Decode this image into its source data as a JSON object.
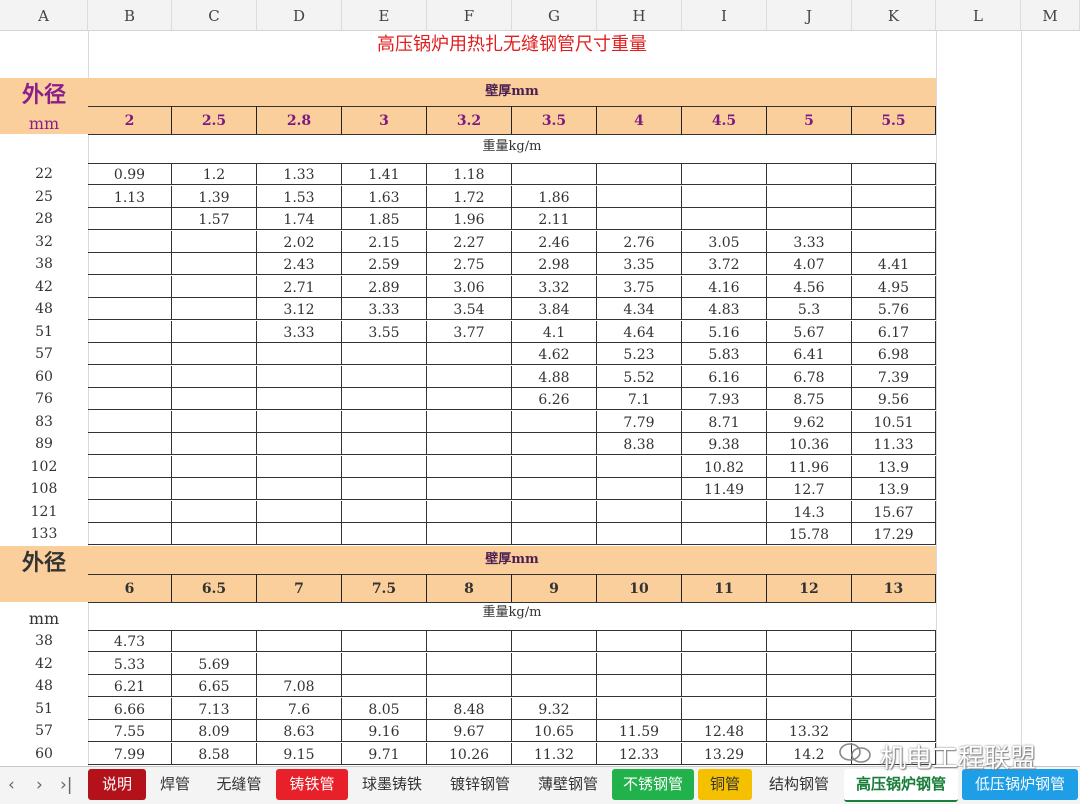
{
  "col_headers": [
    "A",
    "B",
    "C",
    "D",
    "E",
    "F",
    "G",
    "H",
    "I",
    "J",
    "K",
    "L",
    "M"
  ],
  "title": "高压锅炉用热扎无缝钢管尺寸重量",
  "section1": {
    "od_label": "外径",
    "mm_label": "mm",
    "wall_label": "壁厚mm",
    "unit_label": "重量kg/m",
    "thicknesses": [
      "2",
      "2.5",
      "2.8",
      "3",
      "3.2",
      "3.5",
      "4",
      "4.5",
      "5",
      "5.5"
    ],
    "rows": [
      {
        "od": "22",
        "v": [
          "0.99",
          "1.2",
          "1.33",
          "1.41",
          "1.18",
          "",
          "",
          "",
          "",
          ""
        ]
      },
      {
        "od": "25",
        "v": [
          "1.13",
          "1.39",
          "1.53",
          "1.63",
          "1.72",
          "1.86",
          "",
          "",
          "",
          ""
        ]
      },
      {
        "od": "28",
        "v": [
          "",
          "1.57",
          "1.74",
          "1.85",
          "1.96",
          "2.11",
          "",
          "",
          "",
          ""
        ]
      },
      {
        "od": "32",
        "v": [
          "",
          "",
          "2.02",
          "2.15",
          "2.27",
          "2.46",
          "2.76",
          "3.05",
          "3.33",
          ""
        ]
      },
      {
        "od": "38",
        "v": [
          "",
          "",
          "2.43",
          "2.59",
          "2.75",
          "2.98",
          "3.35",
          "3.72",
          "4.07",
          "4.41"
        ]
      },
      {
        "od": "42",
        "v": [
          "",
          "",
          "2.71",
          "2.89",
          "3.06",
          "3.32",
          "3.75",
          "4.16",
          "4.56",
          "4.95"
        ]
      },
      {
        "od": "48",
        "v": [
          "",
          "",
          "3.12",
          "3.33",
          "3.54",
          "3.84",
          "4.34",
          "4.83",
          "5.3",
          "5.76"
        ]
      },
      {
        "od": "51",
        "v": [
          "",
          "",
          "3.33",
          "3.55",
          "3.77",
          "4.1",
          "4.64",
          "5.16",
          "5.67",
          "6.17"
        ]
      },
      {
        "od": "57",
        "v": [
          "",
          "",
          "",
          "",
          "",
          "4.62",
          "5.23",
          "5.83",
          "6.41",
          "6.98"
        ]
      },
      {
        "od": "60",
        "v": [
          "",
          "",
          "",
          "",
          "",
          "4.88",
          "5.52",
          "6.16",
          "6.78",
          "7.39"
        ]
      },
      {
        "od": "76",
        "v": [
          "",
          "",
          "",
          "",
          "",
          "6.26",
          "7.1",
          "7.93",
          "8.75",
          "9.56"
        ]
      },
      {
        "od": "83",
        "v": [
          "",
          "",
          "",
          "",
          "",
          "",
          "7.79",
          "8.71",
          "9.62",
          "10.51"
        ]
      },
      {
        "od": "89",
        "v": [
          "",
          "",
          "",
          "",
          "",
          "",
          "8.38",
          "9.38",
          "10.36",
          "11.33"
        ]
      },
      {
        "od": "102",
        "v": [
          "",
          "",
          "",
          "",
          "",
          "",
          "",
          "10.82",
          "11.96",
          "13.9"
        ]
      },
      {
        "od": "108",
        "v": [
          "",
          "",
          "",
          "",
          "",
          "",
          "",
          "11.49",
          "12.7",
          "13.9"
        ]
      },
      {
        "od": "121",
        "v": [
          "",
          "",
          "",
          "",
          "",
          "",
          "",
          "",
          "14.3",
          "15.67"
        ]
      },
      {
        "od": "133",
        "v": [
          "",
          "",
          "",
          "",
          "",
          "",
          "",
          "",
          "15.78",
          "17.29"
        ]
      }
    ]
  },
  "section2": {
    "od_label": "外径",
    "mm_label": "mm",
    "wall_label": "壁厚mm",
    "unit_label": "重量kg/m",
    "thicknesses": [
      "6",
      "6.5",
      "7",
      "7.5",
      "8",
      "9",
      "10",
      "11",
      "12",
      "13"
    ],
    "rows": [
      {
        "od": "38",
        "v": [
          "4.73",
          "",
          "",
          "",
          "",
          "",
          "",
          "",
          "",
          ""
        ]
      },
      {
        "od": "42",
        "v": [
          "5.33",
          "5.69",
          "",
          "",
          "",
          "",
          "",
          "",
          "",
          ""
        ]
      },
      {
        "od": "48",
        "v": [
          "6.21",
          "6.65",
          "7.08",
          "",
          "",
          "",
          "",
          "",
          "",
          ""
        ]
      },
      {
        "od": "51",
        "v": [
          "6.66",
          "7.13",
          "7.6",
          "8.05",
          "8.48",
          "9.32",
          "",
          "",
          "",
          ""
        ]
      },
      {
        "od": "57",
        "v": [
          "7.55",
          "8.09",
          "8.63",
          "9.16",
          "9.67",
          "10.65",
          "11.59",
          "12.48",
          "13.32",
          ""
        ]
      },
      {
        "od": "60",
        "v": [
          "7.99",
          "8.58",
          "9.15",
          "9.71",
          "10.26",
          "11.32",
          "12.33",
          "13.29",
          "14.2",
          ""
        ]
      }
    ]
  },
  "tabs": [
    {
      "label": "说明",
      "style": "darkred"
    },
    {
      "label": "焊管",
      "style": "plain"
    },
    {
      "label": "无缝管",
      "style": "plain"
    },
    {
      "label": "铸铁管",
      "style": "red"
    },
    {
      "label": "球墨铸铁",
      "style": "plain"
    },
    {
      "label": "镀锌钢管",
      "style": "plain"
    },
    {
      "label": "薄壁钢管",
      "style": "plain"
    },
    {
      "label": "不锈钢管",
      "style": "green"
    },
    {
      "label": "铜管",
      "style": "yellow"
    },
    {
      "label": "结构钢管",
      "style": "plain"
    },
    {
      "label": "高压锅炉钢管",
      "style": "active"
    },
    {
      "label": "低压锅炉钢管",
      "style": "blue"
    }
  ],
  "nav_icons": [
    "prev-icon",
    "next-icon",
    "last-icon"
  ],
  "watermark": "机电工程联盟"
}
